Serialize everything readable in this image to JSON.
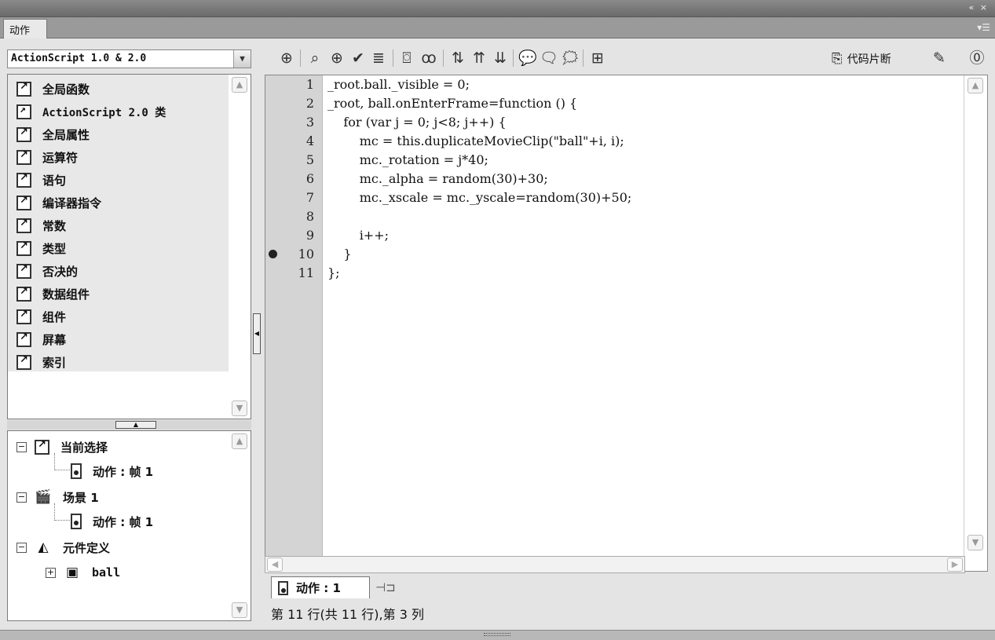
{
  "panel": {
    "tab_label": "动作",
    "window_controls": "« ×",
    "menu_icon": "panel-menu-icon"
  },
  "left": {
    "version_select": "ActionScript 1.0 & 2.0",
    "toolbox_items": [
      "全局函数",
      "ActionScript 2.0 类",
      "全局属性",
      "运算符",
      "语句",
      "编译器指令",
      "常数",
      "类型",
      "否决的",
      "数据组件",
      "组件",
      "屏幕",
      "索引"
    ],
    "script_nav": {
      "current_selection": "当前选择",
      "current_frame": "动作 : 帧 1",
      "scene": "场景 1",
      "scene_frame": "动作 : 帧 1",
      "symbol_defs": "元件定义",
      "symbol_ball": "ball"
    }
  },
  "toolbar": {
    "icons": [
      "add-item-icon",
      "find-icon",
      "insert-target-path-icon",
      "check-syntax-icon",
      "auto-format-icon",
      "show-code-hint-icon",
      "debug-options-icon",
      "collapse-between-braces-icon",
      "collapse-selection-icon",
      "expand-all-icon",
      "apply-block-comment-icon",
      "apply-line-comment-icon",
      "remove-comment-icon",
      "show-hide-toolbox-icon"
    ],
    "snippets_label": "代码片断",
    "script_assist_icon": "script-assist-icon",
    "help_icon": "help-icon"
  },
  "editor": {
    "lines": [
      "_root.ball._visible = 0;",
      "_root, ball.onEnterFrame=function () {",
      "    for (var j = 0; j<8; j++) {",
      "        mc = this.duplicateMovieClip(\"ball\"+i, i);",
      "        mc._rotation = j*40;",
      "        mc._alpha = random(30)+30;",
      "        mc._xscale = mc._yscale=random(30)+50;",
      "",
      "        i++;",
      "    }",
      "};"
    ],
    "line_numbers": [
      "1",
      "2",
      "3",
      "4",
      "5",
      "6",
      "7",
      "8",
      "9",
      "10",
      "11"
    ],
    "breakpoint_line": 10
  },
  "script_tab": {
    "label": "动作 : 1"
  },
  "status": {
    "text": "第 11 行(共 11 行),第 3 列"
  }
}
